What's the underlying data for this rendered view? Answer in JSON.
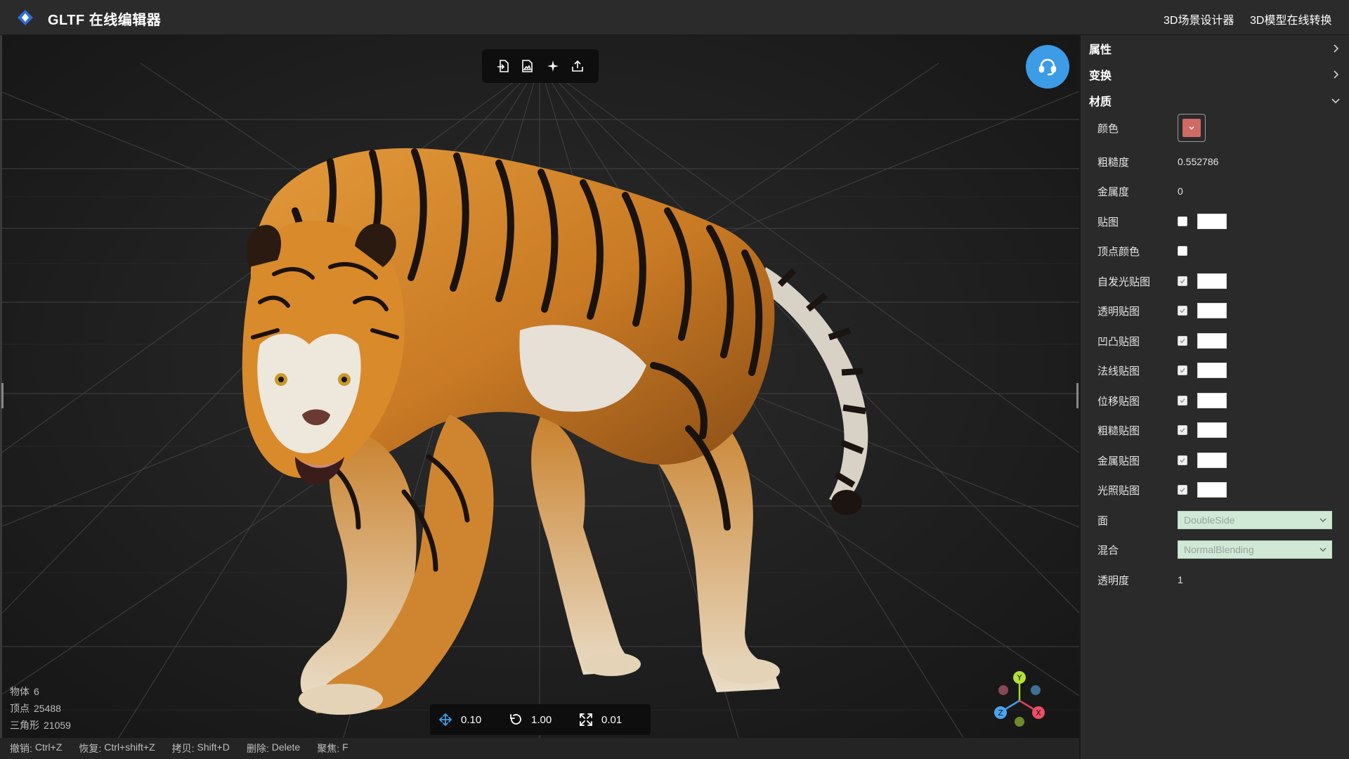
{
  "header": {
    "title": "GLTF 在线编辑器",
    "links": [
      "3D场景设计器",
      "3D模型在线转换"
    ]
  },
  "toolbar": {
    "icons": [
      "import-file-icon",
      "import-image-icon",
      "light-icon",
      "export-icon"
    ]
  },
  "stats": {
    "objects_label": "物体",
    "objects": "6",
    "vertices_label": "顶点",
    "vertices": "25488",
    "triangles_label": "三角形",
    "triangles": "21059"
  },
  "transform_steps": {
    "move": "0.10",
    "rotate": "1.00",
    "scale": "0.01"
  },
  "shortcuts": [
    {
      "label": "撤销:",
      "key": "Ctrl+Z"
    },
    {
      "label": "恢复:",
      "key": "Ctrl+shift+Z"
    },
    {
      "label": "拷贝:",
      "key": "Shift+D"
    },
    {
      "label": "删除:",
      "key": "Delete"
    },
    {
      "label": "聚焦:",
      "key": "F"
    }
  ],
  "axes": {
    "x": "X",
    "y": "Y",
    "z": "Z"
  },
  "panel": {
    "sections": {
      "attributes": "属性",
      "transform": "变换",
      "material": "材质"
    },
    "material": {
      "color_label": "颜色",
      "color_value": "#cf6a64",
      "roughness_label": "粗糙度",
      "roughness": "0.552786",
      "metalness_label": "金属度",
      "metalness": "0",
      "map_label": "贴图",
      "vertex_colors_label": "顶点颜色",
      "emissive_map_label": "自发光贴图",
      "alpha_map_label": "透明贴图",
      "bump_map_label": "凹凸贴图",
      "normal_map_label": "法线贴图",
      "displacement_map_label": "位移贴图",
      "roughness_map_label": "粗糙贴图",
      "metalness_map_label": "金属贴图",
      "light_map_label": "光照贴图",
      "side_label": "面",
      "side": "DoubleSide",
      "blending_label": "混合",
      "blending": "NormalBlending",
      "opacity_label": "透明度",
      "opacity": "1"
    }
  },
  "colors": {
    "accent": "#3d9ce6",
    "panel_bg": "#2a2a2a",
    "select_bg": "#cfe9d6",
    "tiger_orange": "#d98a2b"
  }
}
